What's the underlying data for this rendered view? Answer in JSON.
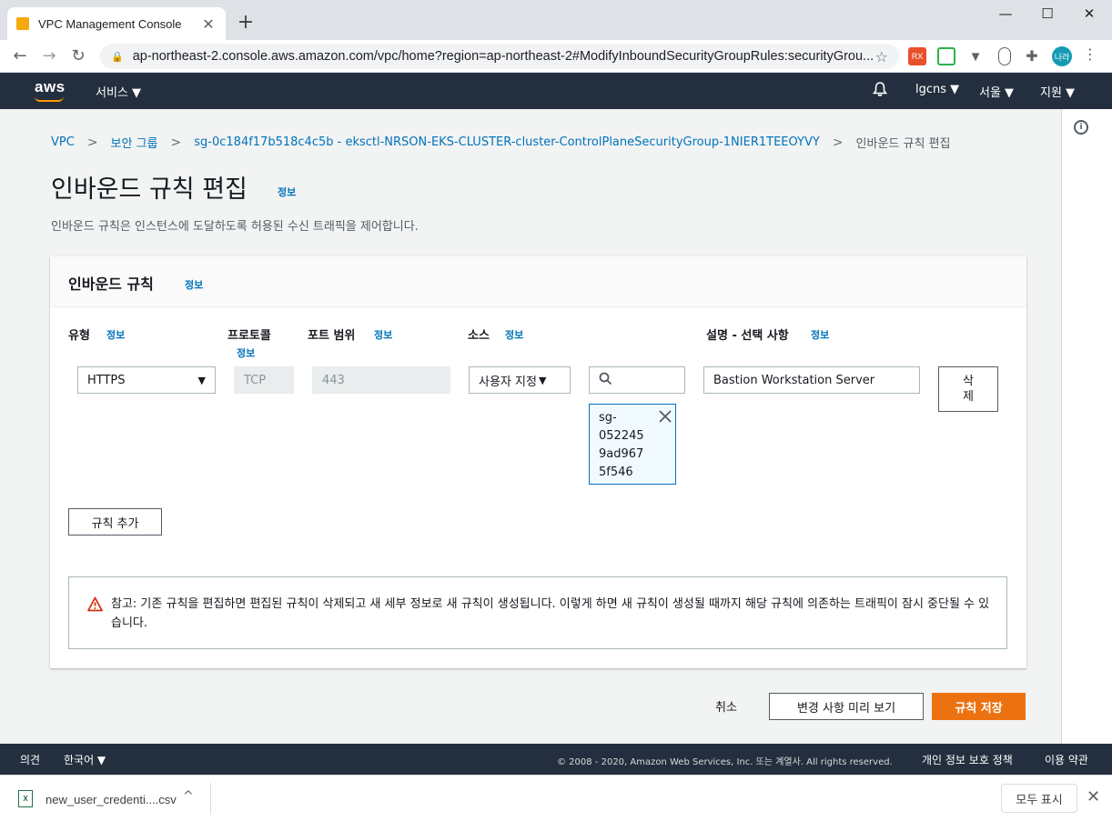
{
  "browser": {
    "tab_title": "VPC Management Console",
    "tab_close": "✕",
    "new_tab": "+",
    "win_minimize": "—",
    "win_maximize": "☐",
    "win_close": "✕",
    "back": "←",
    "forward": "→",
    "reload": "↻",
    "lock": "🔒",
    "url": "ap-northeast-2.console.aws.amazon.com/vpc/home?region=ap-northeast-2#ModifyInboundSecurityGroupRules:securityGrou...",
    "star": "☆",
    "profile_initials": "나라",
    "menu": "⋮",
    "extensions": [
      "rx-extension-icon",
      "green-extension-icon",
      "vuejs-extension-icon",
      "mouse-extension-icon",
      "puzzle-extension-icon"
    ]
  },
  "aws_nav": {
    "logo": "aws",
    "services": "서비스 ▼",
    "account": "lgcns ▼",
    "region": "서울 ▼",
    "support": "지원 ▼"
  },
  "breadcrumb": {
    "items": [
      "VPC",
      "보안 그룹",
      "sg-0c184f17b518c4c5b - eksctl-NRSON-EKS-CLUSTER-cluster-ControlPlaneSecurityGroup-1NIER1TEEOYVY"
    ],
    "current": "인바운드 규칙 편집",
    "separator": ">"
  },
  "page": {
    "title": "인바운드 규칙 편집",
    "info": "정보",
    "description": "인바운드 규칙은 인스턴스에 도달하도록 허용된 수신 트래픽을 제어합니다."
  },
  "panel": {
    "title": "인바운드 규칙",
    "info": "정보",
    "columns": {
      "type": "유형",
      "protocol": "프로토콜",
      "port_range": "포트 범위",
      "source": "소스",
      "description": "설명 - 선택 사항",
      "info": "정보"
    },
    "rule": {
      "type": "HTTPS",
      "protocol": "TCP",
      "port_range": "443",
      "source_type": "사용자 지정",
      "search_value": "",
      "source_token": "sg-\n052245\n9ad967\n5f546",
      "description": "Bastion Workstation Server",
      "delete": "삭\n제"
    },
    "add_rule": "규칙 추가",
    "alert": "참고: 기존 규칙을 편집하면 편집된 규칙이 삭제되고 새 세부 정보로 새 규칙이 생성됩니다. 이렇게 하면 새 규칙이 생성될 때까지 해당 규칙에 의존하는 트래픽이 잠시 중단될 수 있습니다."
  },
  "actions": {
    "cancel": "취소",
    "preview": "변경 사항 미리 보기",
    "save": "규칙 저장"
  },
  "aws_footer": {
    "feedback": "의견",
    "language": "한국어 ▼",
    "copyright": "© 2008 - 2020, Amazon Web Services, Inc. 또는 계열사. All rights reserved.",
    "privacy": "개인 정보 보호 정책",
    "terms": "이용 약관"
  },
  "download_bar": {
    "file_name": "new_user_credenti....csv",
    "chevron": "^",
    "show_all": "모두 표시",
    "close": "✕"
  },
  "colors": {
    "aws_nav": "#232f3e",
    "link": "#0073bb",
    "primary_button": "#ec7211",
    "warning": "#d13212"
  }
}
